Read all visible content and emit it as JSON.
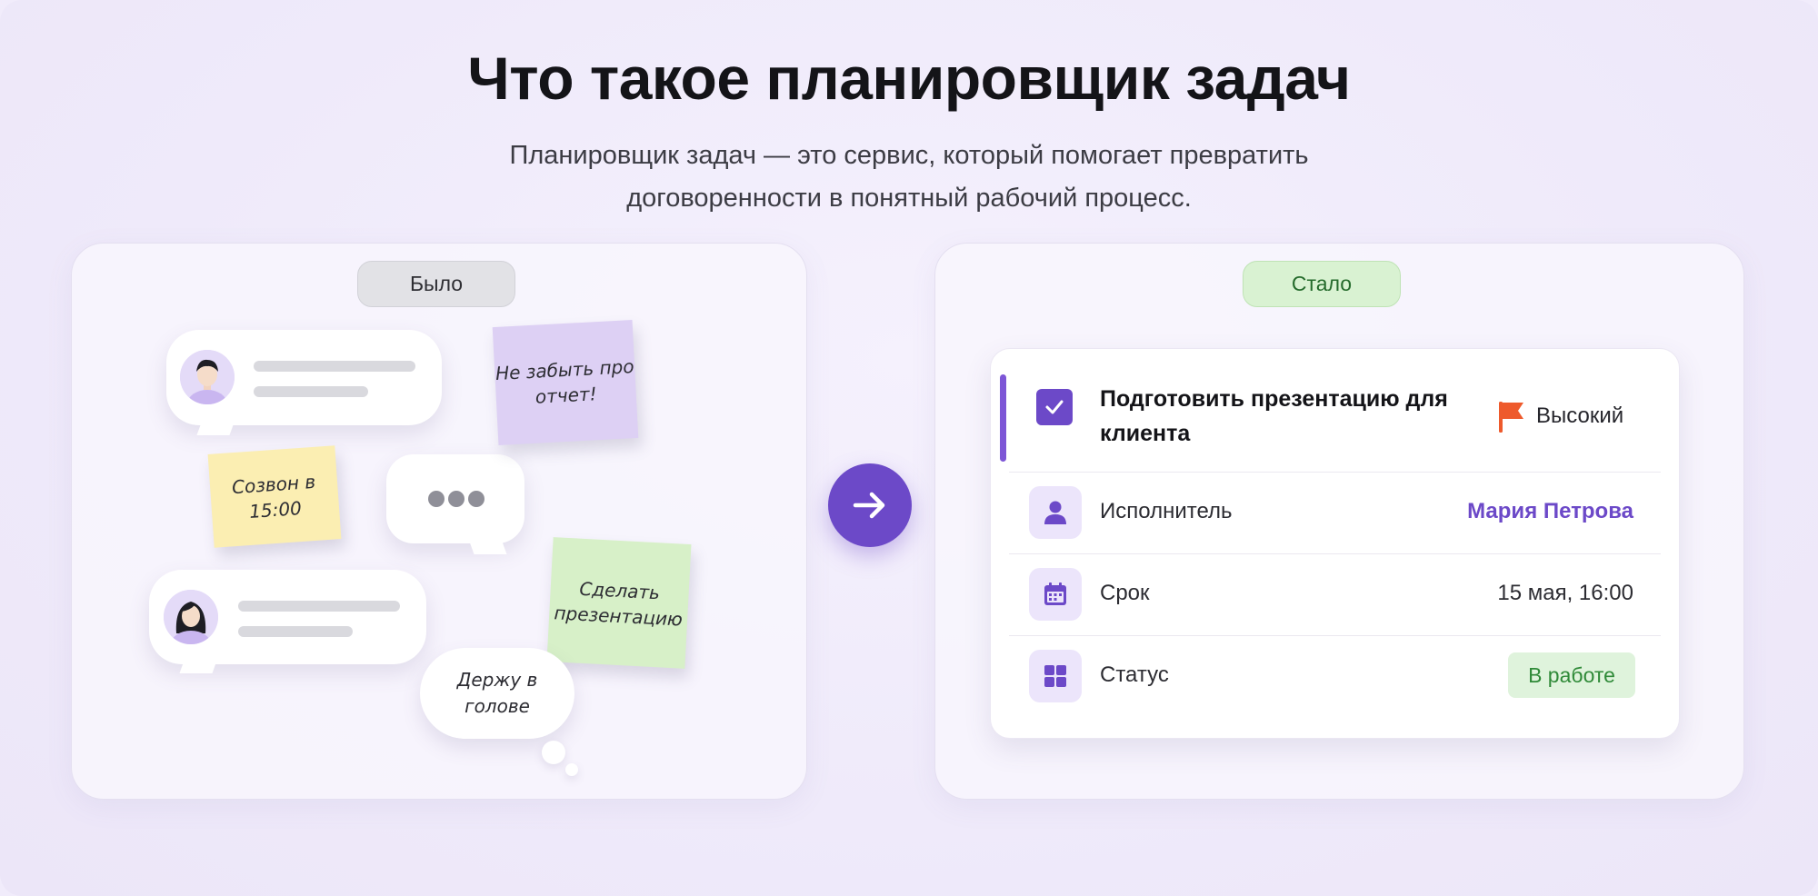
{
  "header": {
    "title": "Что такое планировщик задач",
    "subtitle_line1": "Планировщик задач — это сервис, который помогает превратить",
    "subtitle_line2": "договоренности в понятный рабочий процесс."
  },
  "before": {
    "label": "Было",
    "sticky_purple": "Не забыть про отчет!",
    "sticky_yellow": "Созвон в 15:00",
    "sticky_green": "Сделать презентацию",
    "cloud": "Держу в голове"
  },
  "after": {
    "label": "Стало",
    "task": {
      "title": "Подготовить презентацию для клиента",
      "priority": "Высокий",
      "assignee_label": "Исполнитель",
      "assignee_value": "Мария Петрова",
      "deadline_label": "Срок",
      "deadline_value": "15 мая, 16:00",
      "status_label": "Статус",
      "status_value": "В работе"
    }
  },
  "colors": {
    "accent": "#6c49c8",
    "flag": "#ee5a2c",
    "status_green": "#2f8a38"
  },
  "icons": [
    "chat-avatar-man",
    "chat-avatar-woman",
    "arrow-right-icon",
    "checkbox-icon",
    "flag-icon",
    "user-icon",
    "calendar-icon",
    "status-grid-icon"
  ]
}
